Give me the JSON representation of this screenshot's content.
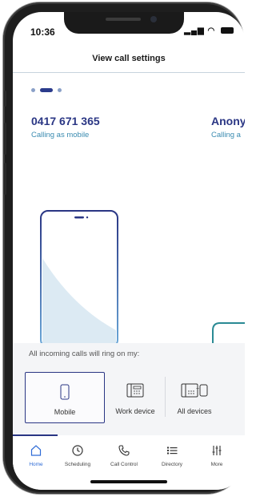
{
  "status": {
    "time": "10:36",
    "signal": "signal-icon",
    "wifi": "wifi-icon",
    "battery": "battery-icon"
  },
  "header": {
    "title": "View call settings"
  },
  "pager": {
    "count": 3,
    "active": 1
  },
  "cards": [
    {
      "number": "0417 671 365",
      "subtitle": "Calling as mobile"
    },
    {
      "number": "Anony",
      "subtitle": "Calling a"
    }
  ],
  "ring": {
    "label": "All incoming calls will ring on my:",
    "options": [
      {
        "label": "Mobile",
        "icon": "mobile-icon",
        "selected": true
      },
      {
        "label": "Work device",
        "icon": "desk-phone-icon",
        "selected": false
      },
      {
        "label": "All devices",
        "icon": "all-devices-icon",
        "selected": false
      }
    ]
  },
  "tabs": [
    {
      "label": "Home",
      "icon": "home-icon",
      "active": true
    },
    {
      "label": "Scheduling",
      "icon": "clock-icon",
      "active": false
    },
    {
      "label": "Call Control",
      "icon": "phone-handset-icon",
      "active": false
    },
    {
      "label": "Directory",
      "icon": "list-icon",
      "active": false
    },
    {
      "label": "More",
      "icon": "sliders-icon",
      "active": false
    }
  ],
  "colors": {
    "primary": "#2a3684",
    "accent": "#3a8bb0",
    "tab_active": "#2e6bd6"
  }
}
